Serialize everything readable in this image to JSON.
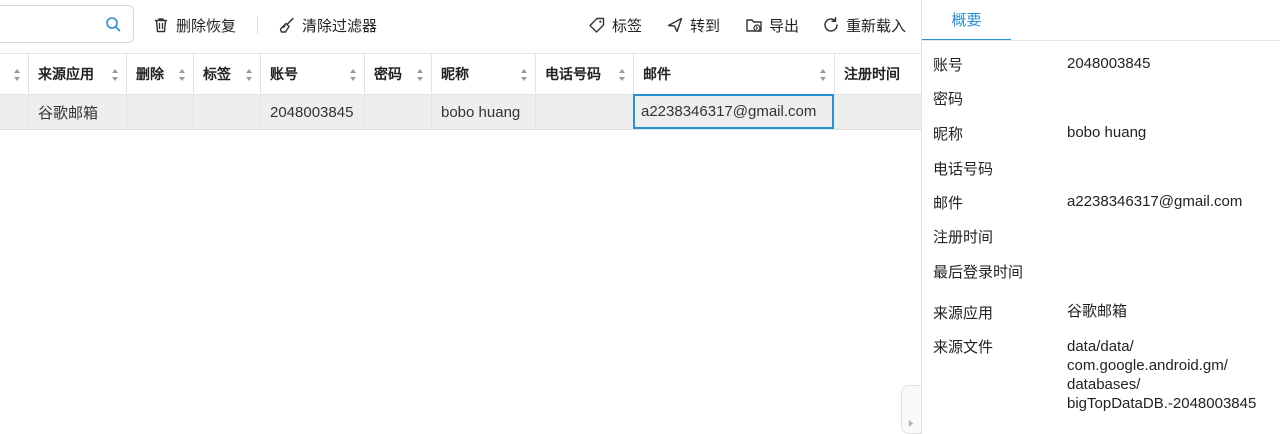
{
  "toolbar": {
    "delete_restore": "删除恢复",
    "clear_filters": "清除过滤器",
    "tag": "标签",
    "goto": "转到",
    "export": "导出",
    "reload": "重新载入"
  },
  "table": {
    "columns": [
      "来源应用",
      "删除",
      "标签",
      "账号",
      "密码",
      "昵称",
      "电话号码",
      "邮件",
      "注册时间"
    ],
    "rows": [
      {
        "source_app": "谷歌邮箱",
        "deleted": "",
        "tag": "",
        "account": "2048003845",
        "password": "",
        "nickname": "bobo huang",
        "phone": "",
        "email": "a2238346317@gmail.com",
        "register_time": ""
      }
    ]
  },
  "details": {
    "tab": "概要",
    "fields": [
      {
        "label": "账号",
        "value": "2048003845"
      },
      {
        "label": "密码",
        "value": ""
      },
      {
        "label": "昵称",
        "value": "bobo huang"
      },
      {
        "label": "电话号码",
        "value": ""
      },
      {
        "label": "邮件",
        "value": "a2238346317@gmail.com"
      },
      {
        "label": "注册时间",
        "value": ""
      },
      {
        "label": "最后登录时间",
        "value": ""
      },
      {
        "label": "来源应用",
        "value": "谷歌邮箱"
      },
      {
        "label": "来源文件",
        "value_lines": [
          "data/data/",
          "com.google.android.gm/",
          "databases/",
          "bigTopDataDB.-2048003845"
        ]
      }
    ]
  },
  "colors": {
    "accent": "#2a8fd7",
    "selected_row": "#eeeeee"
  },
  "icons": [
    "search-icon",
    "trash-icon",
    "broom-icon",
    "tag-icon",
    "goto-icon",
    "export-icon",
    "reload-icon",
    "sort-icon",
    "chevron-right-icon"
  ]
}
